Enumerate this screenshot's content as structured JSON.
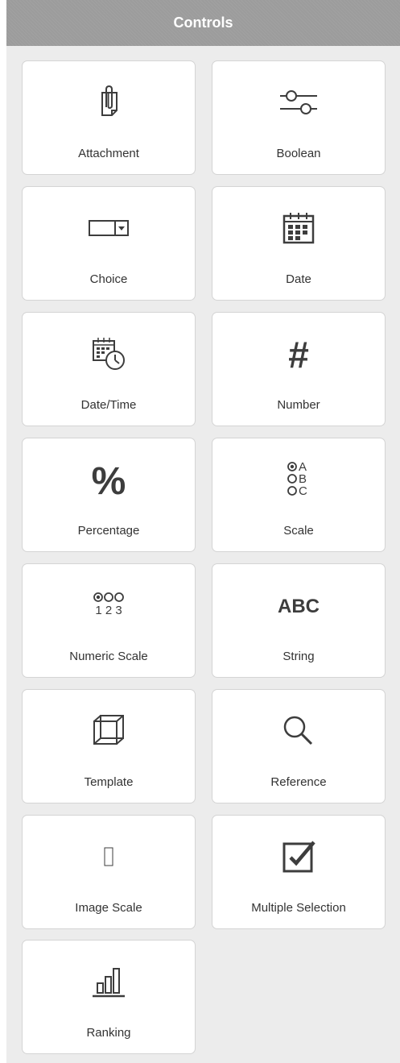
{
  "panel": {
    "title": "Controls"
  },
  "icon_color": "#3d3d3d",
  "controls": [
    {
      "label": "Attachment",
      "icon": "paperclip-icon"
    },
    {
      "label": "Boolean",
      "icon": "toggle-sliders-icon"
    },
    {
      "label": "Choice",
      "icon": "dropdown-icon"
    },
    {
      "label": "Date",
      "icon": "calendar-icon"
    },
    {
      "label": "Date/Time",
      "icon": "calendar-clock-icon"
    },
    {
      "label": "Number",
      "icon": "hash-icon",
      "glyph": "#"
    },
    {
      "label": "Percentage",
      "icon": "percent-icon",
      "glyph": "%"
    },
    {
      "label": "Scale",
      "icon": "radio-abc-icon",
      "glyph_letters": [
        "A",
        "B",
        "C"
      ]
    },
    {
      "label": "Numeric Scale",
      "icon": "radio-123-icon",
      "glyph_digits": "1 2 3"
    },
    {
      "label": "String",
      "icon": "abc-text-icon",
      "glyph": "ABC"
    },
    {
      "label": "Template",
      "icon": "cube-icon"
    },
    {
      "label": "Reference",
      "icon": "magnifier-icon"
    },
    {
      "label": "Image Scale",
      "icon": "missing-glyph-icon"
    },
    {
      "label": "Multiple Selection",
      "icon": "checkbox-checked-icon"
    },
    {
      "label": "Ranking",
      "icon": "bar-chart-icon"
    }
  ]
}
